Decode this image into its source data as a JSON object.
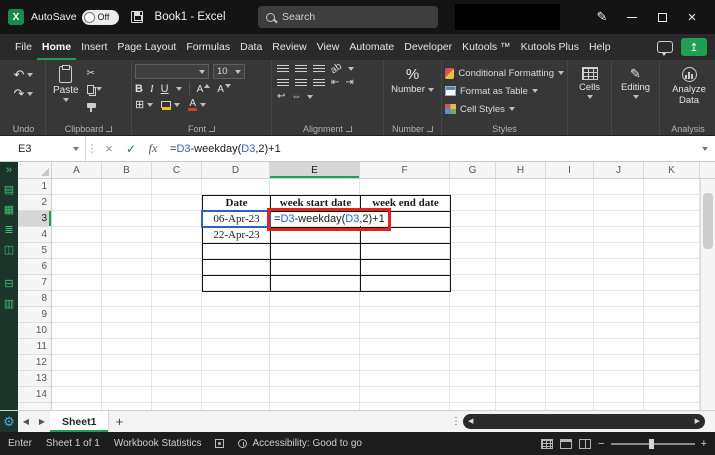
{
  "colors": {
    "accent_green": "#1f9e54",
    "annotation_red": "#e1241b",
    "reference_blue": "#2a62c9"
  },
  "icons": {
    "excel": "X",
    "undo": "↶",
    "redo": "↷",
    "cut": "✂",
    "borders": "⊞",
    "bold": "B",
    "italic": "I",
    "underline": "U",
    "letterA": "A",
    "percent": "%",
    "wrap": "↩",
    "merge": "⇔",
    "indent_dec": "⇤",
    "indent_inc": "⇥",
    "orient": "ab",
    "pencil": "✎",
    "pen": "✎",
    "gear": "⚙",
    "chevrons": "»",
    "kut1": "▤",
    "kut2": "▦",
    "kut3": "≣",
    "kut4": "◫",
    "kut5": "⊟",
    "kut6": "▥",
    "prev": "◀",
    "next": "▶",
    "dots": "⋮",
    "close": "×",
    "cancel": "×",
    "check": "✓",
    "share": "↥",
    "plus": "+",
    "minus": "−"
  },
  "titlebar": {
    "autosave_label": "AutoSave",
    "autosave_state": "Off",
    "doc_title": "Book1 - Excel",
    "search_placeholder": "Search"
  },
  "menubar": {
    "tabs": [
      "File",
      "Home",
      "Insert",
      "Page Layout",
      "Formulas",
      "Data",
      "Review",
      "View",
      "Automate",
      "Developer",
      "Kutools ™",
      "Kutools Plus",
      "Help"
    ],
    "active_tab": "Home"
  },
  "ribbon": {
    "undo_label": "Undo",
    "clipboard": {
      "paste": "Paste",
      "label": "Clipboard"
    },
    "font": {
      "size": "10",
      "label": "Font"
    },
    "alignment_label": "Alignment",
    "number": {
      "button": "Number",
      "label": "Number"
    },
    "styles": {
      "items": [
        "Conditional Formatting",
        "Format as Table",
        "Cell Styles"
      ],
      "label": "Styles"
    },
    "cells_label": "Cells",
    "editing_label": "Editing",
    "analysis": {
      "button": "Analyze Data",
      "label": "Analysis"
    }
  },
  "formula_bar": {
    "name_box": "E3",
    "fx": "fx",
    "tokens": [
      {
        "t": "=",
        "c": "#1a1a1a"
      },
      {
        "t": "D3",
        "c": "#2a62c9"
      },
      {
        "t": "-weekday(",
        "c": "#1a1a1a"
      },
      {
        "t": "D3",
        "c": "#2a62c9"
      },
      {
        "t": ",2)+1",
        "c": "#1a1a1a"
      }
    ]
  },
  "grid": {
    "columns": [
      "A",
      "B",
      "C",
      "D",
      "E",
      "F",
      "G",
      "H",
      "I",
      "J",
      "K"
    ],
    "rows": [
      "1",
      "2",
      "3",
      "4",
      "5",
      "6",
      "7",
      "8",
      "9",
      "10",
      "11",
      "12",
      "13",
      "14"
    ],
    "selection": {
      "col": "E",
      "row": "3",
      "cell": "E3"
    }
  },
  "table": {
    "headers": [
      "Date",
      "week start date",
      "week end date"
    ],
    "rows": [
      [
        "06-Apr-23"
      ],
      [
        "22-Apr-23"
      ]
    ]
  },
  "sheet_bar": {
    "active_tab": "Sheet1"
  },
  "status_bar": {
    "mode": "Enter",
    "sheet_info": "Sheet 1 of 1",
    "stats": "Workbook Statistics",
    "accessibility": "Accessibility: Good to go"
  }
}
